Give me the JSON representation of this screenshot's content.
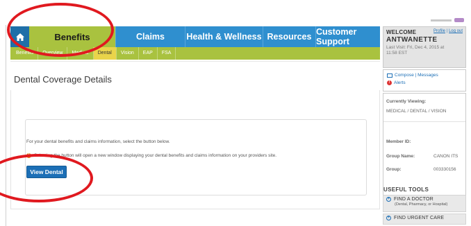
{
  "nav": {
    "home_icon": "home-icon",
    "items": [
      "Benefits",
      "Claims",
      "Health & Wellness",
      "Resources",
      "Customer Support"
    ]
  },
  "subnav": {
    "items": [
      "Benefits",
      "Overview",
      "Medical",
      "Dental",
      "Vision",
      "EAP",
      "FSA"
    ],
    "active": "Dental"
  },
  "page": {
    "title": "Dental Coverage Details",
    "info_text": "For your dental benefits and claims information, select the button below.",
    "warning_text": "Selecting the button will open a new window displaying your dental benefits and claims information on your providers site.",
    "button_label": "View Dental"
  },
  "sidebar": {
    "welcome_label": "WELCOME",
    "profile_link": "Profile",
    "logout_link": "Log out",
    "user_name": "ANTWANETTE",
    "last_visit": "Last Visit: Fri, Dec 4, 2015 at 11:58 EST",
    "compose": "Compose",
    "messages": "Messages",
    "alerts": "Alerts",
    "currently_viewing_label": "Currently Viewing:",
    "currently_viewing_value": "MEDICAL / DENTAL / VISION",
    "member_id_label": "Member ID:",
    "member_id_value": "",
    "group_name_label": "Group Name:",
    "group_name_value": "CANON ITS",
    "group_label": "Group:",
    "group_value": "003330156",
    "useful_tools_title": "USEFUL TOOLS",
    "tools": [
      {
        "label": "FIND A DOCTOR",
        "sub": "(Dental, Pharmacy, or Hospital)"
      },
      {
        "label": "FIND URGENT CARE",
        "sub": ""
      }
    ]
  },
  "colors": {
    "nav_blue": "#2f8fcf",
    "benefits_green": "#a9c23f",
    "button_blue": "#1c6fb6",
    "annotation_red": "#e0191f"
  }
}
